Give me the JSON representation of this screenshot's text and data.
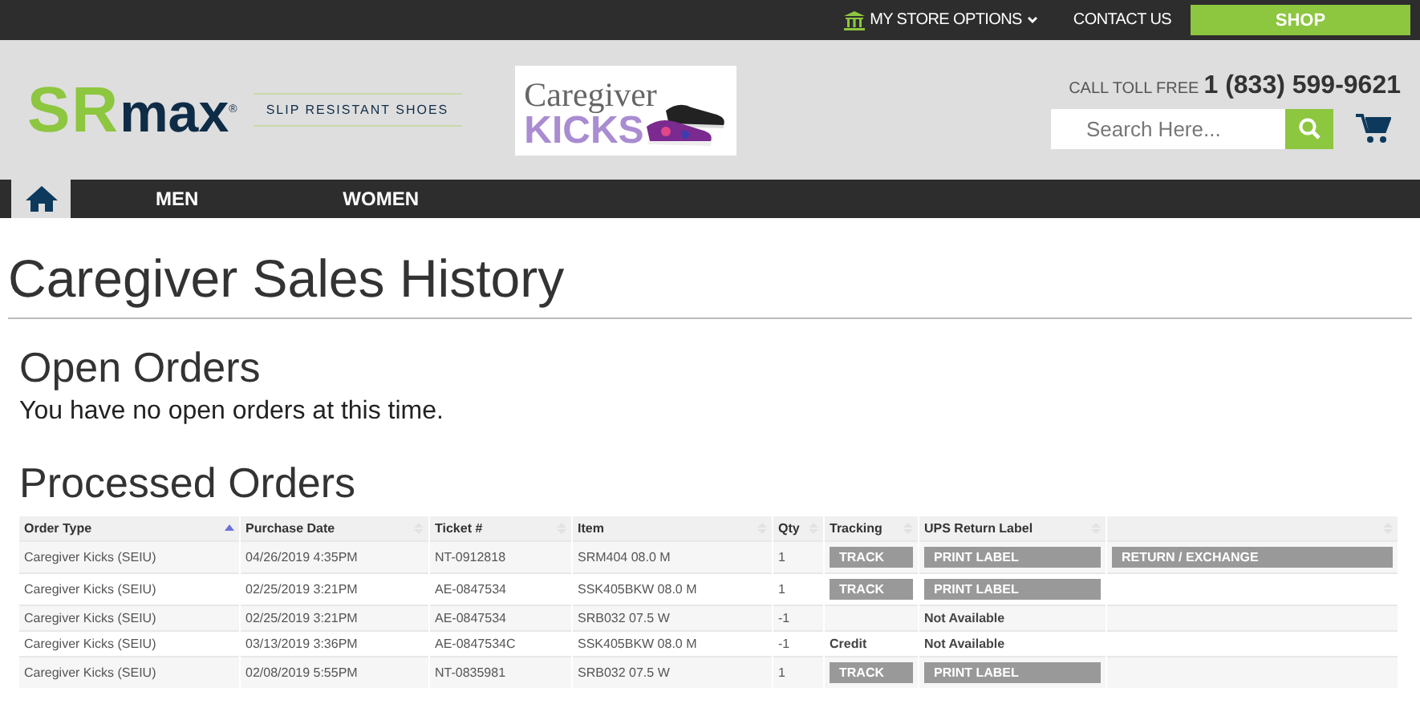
{
  "top_bar": {
    "store_options": "MY STORE OPTIONS",
    "contact": "CONTACT US",
    "shop": "SHOP"
  },
  "header": {
    "logo_main": "SR",
    "logo_rest": "max",
    "logo_mark": "®",
    "tagline": "SLIP RESISTANT SHOES",
    "banner_line1": "Caregiver",
    "banner_line2": "KICKS",
    "toll_free_label": "CALL TOLL FREE",
    "phone": "1 (833) 599-9621",
    "search": {
      "placeholder": "Search Here..."
    }
  },
  "nav": [
    {
      "label": "MEN"
    },
    {
      "label": "WOMEN"
    }
  ],
  "page_title": "Caregiver Sales History",
  "open_orders": {
    "heading": "Open Orders",
    "message": "You have no open orders at this time."
  },
  "processed_orders": {
    "heading": "Processed Orders",
    "columns": [
      {
        "label": "Order Type",
        "sorted": true
      },
      {
        "label": "Purchase Date",
        "sorted": false
      },
      {
        "label": "Ticket #",
        "sorted": false
      },
      {
        "label": "Item",
        "sorted": false
      },
      {
        "label": "Qty",
        "sorted": false
      },
      {
        "label": "Tracking",
        "sorted": false
      },
      {
        "label": "UPS Return Label",
        "sorted": false
      },
      {
        "sorted": false
      }
    ],
    "rows": [
      {
        "order_type": "Caregiver Kicks (SEIU)",
        "date": "04/26/2019 4:35PM",
        "ticket": "NT-0912818",
        "item": "SRM404 08.0 M",
        "qty": "1",
        "tracking": {
          "kind": "button",
          "text": "TRACK"
        },
        "label": {
          "kind": "button",
          "text": "PRINT LABEL"
        },
        "action": {
          "kind": "button",
          "text": "RETURN / EXCHANGE"
        }
      },
      {
        "order_type": "Caregiver Kicks (SEIU)",
        "date": "02/25/2019 3:21PM",
        "ticket": "AE-0847534",
        "item": "SSK405BKW 08.0 M",
        "qty": "1",
        "tracking": {
          "kind": "button",
          "text": "TRACK"
        },
        "label": {
          "kind": "button",
          "text": "PRINT LABEL"
        }
      },
      {
        "order_type": "Caregiver Kicks (SEIU)",
        "date": "02/25/2019 3:21PM",
        "ticket": "AE-0847534",
        "item": "SRB032 07.5 W",
        "qty": "-1",
        "label": {
          "kind": "text",
          "text": "Not Available"
        }
      },
      {
        "order_type": "Caregiver Kicks (SEIU)",
        "date": "03/13/2019 3:36PM",
        "ticket": "AE-0847534C",
        "item": "SSK405BKW 08.0 M",
        "qty": "-1",
        "tracking": {
          "kind": "text",
          "text": "Credit"
        },
        "label": {
          "kind": "text",
          "text": "Not Available"
        }
      },
      {
        "order_type": "Caregiver Kicks (SEIU)",
        "date": "02/08/2019 5:55PM",
        "ticket": "NT-0835981",
        "item": "SRB032 07.5 W",
        "qty": "1",
        "tracking": {
          "kind": "button",
          "text": "TRACK"
        },
        "label": {
          "kind": "button",
          "text": "PRINT LABEL"
        }
      }
    ]
  }
}
